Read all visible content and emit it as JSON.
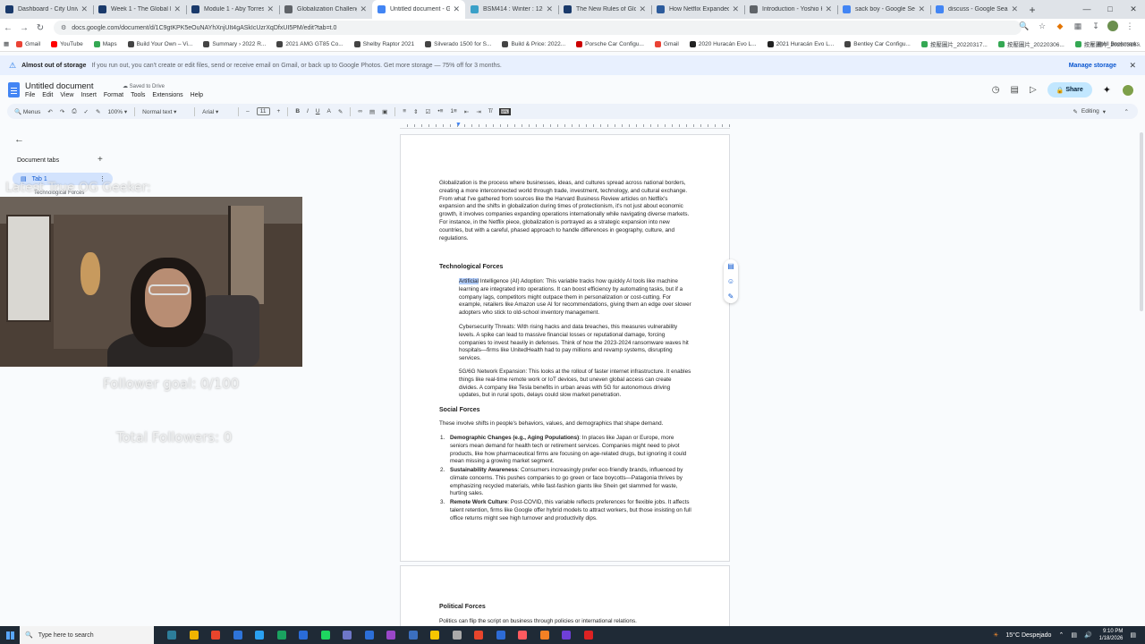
{
  "browser": {
    "tabs": [
      {
        "title": "Dashboard - City Universi",
        "color": "#1a3a6b",
        "active": false
      },
      {
        "title": "Week 1 - The Global Econ",
        "color": "#1a3a6b",
        "active": false
      },
      {
        "title": "Module 1 - Aby Torres - B",
        "color": "#1a3a6b",
        "active": false
      },
      {
        "title": "Globalization Challenges",
        "color": "#5f6368",
        "active": false
      },
      {
        "title": "Untitled document - Goo",
        "color": "#4285f4",
        "active": true
      },
      {
        "title": "BSM414 : Winter : 12631",
        "color": "#3aa0c8",
        "active": false
      },
      {
        "title": "The New Rules of Globali",
        "color": "#1a3a6b",
        "active": false
      },
      {
        "title": "How Netflix Expanded to",
        "color": "#2c5b9c",
        "active": false
      },
      {
        "title": "Introduction - Yoshio K",
        "color": "#5f6368",
        "active": false
      },
      {
        "title": "sack boy - Google Search",
        "color": "#4285f4",
        "active": false
      },
      {
        "title": "discuss - Google Search",
        "color": "#4285f4",
        "active": false
      }
    ],
    "url": "docs.google.com/document/d/1C9gtKPK5eOuNAYhXnjUIt4gASkIcUzrXqDfxUI5PM/edit?tab=t.0",
    "bookmarks": [
      {
        "label": "Gmail",
        "color": "#ea4335"
      },
      {
        "label": "YouTube",
        "color": "#ff0000"
      },
      {
        "label": "Maps",
        "color": "#34a853"
      },
      {
        "label": "Build Your Own – Vi...",
        "color": "#444"
      },
      {
        "label": "Summary › 2022 R...",
        "color": "#444"
      },
      {
        "label": "2021 AMG GT85 Co...",
        "color": "#444"
      },
      {
        "label": "Shelby Raptor 2021",
        "color": "#444"
      },
      {
        "label": "Silverado 1500 for S...",
        "color": "#444"
      },
      {
        "label": "Build & Price: 2022...",
        "color": "#444"
      },
      {
        "label": "Porsche Car Configu...",
        "color": "#c00"
      },
      {
        "label": "Gmail",
        "color": "#ea4335"
      },
      {
        "label": "2020 Huracán Evo L...",
        "color": "#222"
      },
      {
        "label": "2021 Huracán Evo L...",
        "color": "#222"
      },
      {
        "label": "Bentley Car Configu...",
        "color": "#444"
      },
      {
        "label": "按壓圖片_20220317...",
        "color": "#34a853"
      },
      {
        "label": "按壓圖片_20220306...",
        "color": "#34a853"
      },
      {
        "label": "按壓圖片_20220316...",
        "color": "#34a853"
      }
    ],
    "all_bookmarks": "All Bookmarks"
  },
  "banner": {
    "title": "Almost out of storage",
    "message": "If you run out, you can't create or edit files, send or receive email on Gmail, or back up to Google Photos. Get more storage — 75% off for 3 months.",
    "action": "Manage storage"
  },
  "docs": {
    "title": "Untitled document",
    "saved": "Saved to Drive",
    "menu": [
      "File",
      "Edit",
      "View",
      "Insert",
      "Format",
      "Tools",
      "Extensions",
      "Help"
    ],
    "share": "Share",
    "toolbar": {
      "menus": "Menus",
      "zoom": "100%",
      "style": "Normal text",
      "font": "Arial",
      "size": "11",
      "mode": "Editing"
    }
  },
  "sidebar": {
    "label": "Document tabs",
    "tab": "Tab 1",
    "outline": "Technological Forces"
  },
  "stream": {
    "name": "Latest True OG Geeker:",
    "goal": "Follower goal: 0/100",
    "total": "Total Followers: 0"
  },
  "document": {
    "intro": "Globalization is the process where businesses, ideas, and cultures spread across national borders, creating a more interconnected world through trade, investment, technology, and cultural exchange. From what I've gathered from sources like the Harvard Business Review articles on Netflix's expansion and the shifts in globalization during times of protectionism, it's not just about economic growth, it involves companies expanding operations internationally while navigating diverse markets. For instance, in the Netflix piece, globalization is portrayed as a strategic expansion into new countries, but with a careful, phased approach to handle differences in geography, culture, and regulations.",
    "tech_heading": "Technological Forces",
    "ai_highlight": "Artificial",
    "ai_rest": " Intelligence (AI) Adoption: This variable tracks how quickly AI tools like machine learning are integrated into operations. It can boost efficiency by automating tasks, but if a company lags, competitors might outpace them in personalization or cost-cutting. For example, retailers like Amazon use AI for recommendations, giving them an edge over slower adopters who stick to old-school inventory management.",
    "cyber": "Cybersecurity Threats: With rising hacks and data breaches, this measures vulnerability levels. A spike can lead to massive financial losses or reputational damage, forcing companies to invest heavily in defenses. Think of how the 2023-2024 ransomware waves hit hospitals—firms like UnitedHealth had to pay millions and revamp systems, disrupting services.",
    "network": "5G/6G Network Expansion: This looks at the rollout of faster internet infrastructure. It enables things like real-time remote work or IoT devices, but uneven global access can create divides. A company like Tesla benefits in urban areas with 5G for autonomous driving updates, but in rural spots, delays could slow market penetration.",
    "social_heading": "Social Forces",
    "social_intro": "These involve shifts in people's behaviors, values, and demographics that shape demand.",
    "social_items": [
      {
        "num": "1.",
        "bold": "Demographic Changes (e.g., Aging Populations)",
        "text": ": In places like Japan or Europe, more seniors mean demand for health tech or retirement services. Companies might need to pivot products, like how pharmaceutical firms are focusing on age-related drugs, but ignoring it could mean missing a growing market segment."
      },
      {
        "num": "2.",
        "bold": "Sustainability Awareness",
        "text": ": Consumers increasingly prefer eco-friendly brands, influenced by climate concerns. This pushes companies to go green or face boycotts—Patagonia thrives by emphasizing recycled materials, while fast-fashion giants like Shein get slammed for waste, hurting sales."
      },
      {
        "num": "3.",
        "bold": "Remote Work Culture",
        "text": ": Post-COVID, this variable reflects preferences for flexible jobs. It affects talent retention, firms like Google offer hybrid models to attract workers, but those insisting on full office returns might see high turnover and productivity dips."
      }
    ],
    "political_heading": "Political Forces",
    "political_intro": "Politics can flip the script on business through policies or international relations."
  },
  "taskbar": {
    "search": "Type here to search",
    "weather": "15°C  Despejado",
    "time": "9:10 PM",
    "date": "1/18/2026",
    "apps": [
      "#2d7d9a",
      "#f0b400",
      "#e8452c",
      "#2e74d9",
      "#2aa0f0",
      "#1aa260",
      "#2a6cd8",
      "#1ed760",
      "#6e77c7",
      "#2c6fd8",
      "#9a47c9",
      "#3b6fbf",
      "#f7c600",
      "#aaaaaa",
      "#e8452c",
      "#2d6bd6",
      "#ff5a5f",
      "#f48024",
      "#6e3fd8",
      "#d22"
    ]
  }
}
